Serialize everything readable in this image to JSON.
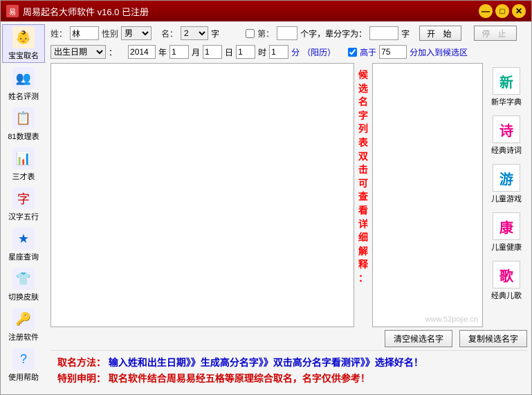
{
  "titlebar": {
    "icon_text": "易",
    "title": "周易起名大师软件 v16.0  已注册"
  },
  "sidebar": [
    {
      "label": "宝宝取名",
      "icon": "👶",
      "active": true,
      "icon_color": "#fc6"
    },
    {
      "label": "姓名评测",
      "icon": "👥",
      "active": false,
      "icon_color": "#4af"
    },
    {
      "label": "81数理表",
      "icon": "📋",
      "active": false,
      "icon_color": "#fa0"
    },
    {
      "label": "三才表",
      "icon": "📊",
      "active": false,
      "icon_color": "#fa0"
    },
    {
      "label": "汉字五行",
      "icon": "字",
      "active": false,
      "icon_color": "#c00"
    },
    {
      "label": "星座查询",
      "icon": "★",
      "active": false,
      "icon_color": "#06c"
    },
    {
      "label": "切换皮肤",
      "icon": "👕",
      "active": false,
      "icon_color": "#0cc"
    },
    {
      "label": "注册软件",
      "icon": "🔑",
      "active": false,
      "icon_color": "#fc0"
    },
    {
      "label": "使用帮助",
      "icon": "?",
      "active": false,
      "icon_color": "#08f"
    }
  ],
  "form": {
    "surname_label": "姓：",
    "surname_value": "林",
    "gender_label": "性别",
    "gender_value": "男",
    "name_label": "名：",
    "name_count": "2",
    "name_unit": "字",
    "di_check": false,
    "di_label": "第：",
    "di_value": "",
    "di_suffix": "个字，辈分字为：",
    "beifen_value": "",
    "beifen_unit": "字",
    "start_btn": "开 始",
    "stop_btn": "停 止",
    "birth_label": "出生日期",
    "birth_unit": "：",
    "year": "2014",
    "year_lbl": "年",
    "month": "1",
    "month_lbl": "月",
    "day": "1",
    "day_lbl": "日",
    "hour": "1",
    "hour_lbl": "时",
    "minute": "1",
    "minute_lbl": "分",
    "calendar": "（阳历）",
    "gaoyu_check": true,
    "gaoyu_label": "高于",
    "gaoyu_value": "75",
    "gaoyu_suffix": "分加入到候选区"
  },
  "mid_hint": "候选名字列表双击可查看详细解释：",
  "right_tools": [
    {
      "label": "新华字典",
      "icon": "新",
      "color": "#0a8"
    },
    {
      "label": "经典诗词",
      "icon": "诗",
      "color": "#e08"
    },
    {
      "label": "儿童游戏",
      "icon": "游",
      "color": "#08c"
    },
    {
      "label": "儿童健康",
      "icon": "康",
      "color": "#e08"
    },
    {
      "label": "经典儿歌",
      "icon": "歌",
      "color": "#e08"
    }
  ],
  "bottom_btns": {
    "clear": "清空候选名字",
    "copy": "复制候选名字"
  },
  "footer": {
    "l1_prefix": "取名方法：",
    "l1_body": "输入姓和出生日期》》生成高分名字》》双击高分名字看测评》》选择好名！",
    "l2_prefix": "特别申明：",
    "l2_body": "取名软件结合周易易经五格等原理综合取名，名字仅供参考！"
  },
  "watermark": "www.52pojie.cn"
}
